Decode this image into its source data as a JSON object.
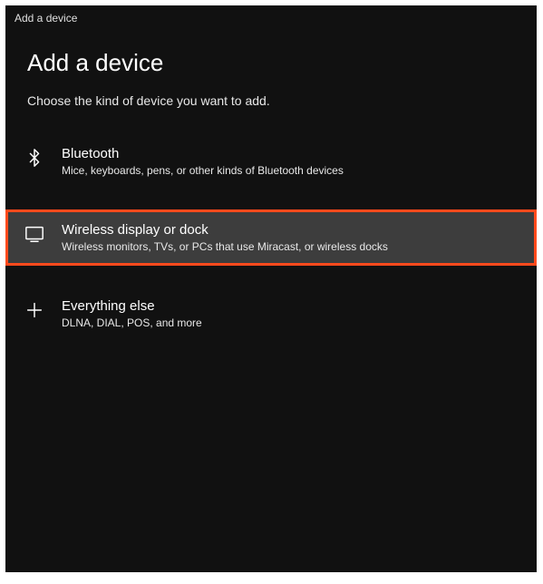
{
  "window": {
    "title": "Add a device"
  },
  "page": {
    "title": "Add a device",
    "subtitle": "Choose the kind of device you want to add."
  },
  "options": [
    {
      "icon": "bluetooth-icon",
      "title": "Bluetooth",
      "desc": "Mice, keyboards, pens, or other kinds of Bluetooth devices",
      "selected": false
    },
    {
      "icon": "display-icon",
      "title": "Wireless display or dock",
      "desc": "Wireless monitors, TVs, or PCs that use Miracast, or wireless docks",
      "selected": true
    },
    {
      "icon": "plus-icon",
      "title": "Everything else",
      "desc": "DLNA, DIAL, POS, and more",
      "selected": false
    }
  ],
  "colors": {
    "highlight_border": "#ff4a1c",
    "selected_bg": "#3d3d3d",
    "window_bg": "#111111"
  }
}
